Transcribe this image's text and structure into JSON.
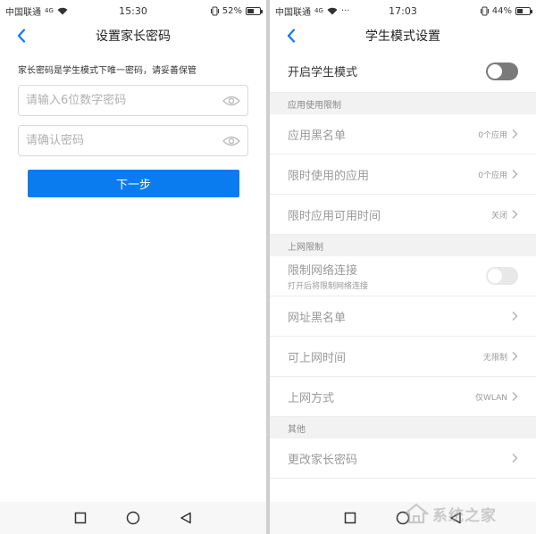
{
  "left": {
    "status": {
      "carrier": "中国联通",
      "signal": "4G",
      "time": "15:30",
      "battery": "52%",
      "battery_level": 52
    },
    "title": "设置家长密码",
    "hint": "家长密码是学生模式下唯一密码，请妥善保管",
    "password_placeholder": "请输入6位数字密码",
    "confirm_placeholder": "请确认密码",
    "next_label": "下一步"
  },
  "right": {
    "status": {
      "carrier": "中国联通",
      "signal": "4G",
      "extra": "···",
      "time": "17:03",
      "battery": "44%",
      "battery_level": 44
    },
    "title": "学生模式设置",
    "enable_label": "开启学生模式",
    "sections": {
      "app": "应用使用限制",
      "net": "上网限制",
      "other": "其他"
    },
    "rows": {
      "blacklist": {
        "label": "应用黑名单",
        "value": "0个应用"
      },
      "timed_apps": {
        "label": "限时使用的应用",
        "value": "0个应用"
      },
      "timed_hours": {
        "label": "限时应用可用时间",
        "value": "关闭"
      },
      "net_limit": {
        "label": "限制网络连接",
        "sub": "打开后将限制网络连接"
      },
      "url_blacklist": {
        "label": "网址黑名单"
      },
      "net_time": {
        "label": "可上网时间",
        "value": "无限制"
      },
      "net_mode": {
        "label": "上网方式",
        "value": "仅WLAN"
      },
      "change_pw": {
        "label": "更改家长密码"
      }
    }
  },
  "watermark": "系统之家",
  "colors": {
    "accent": "#0a7cf0",
    "toggle_off": "#7a7a7a"
  }
}
